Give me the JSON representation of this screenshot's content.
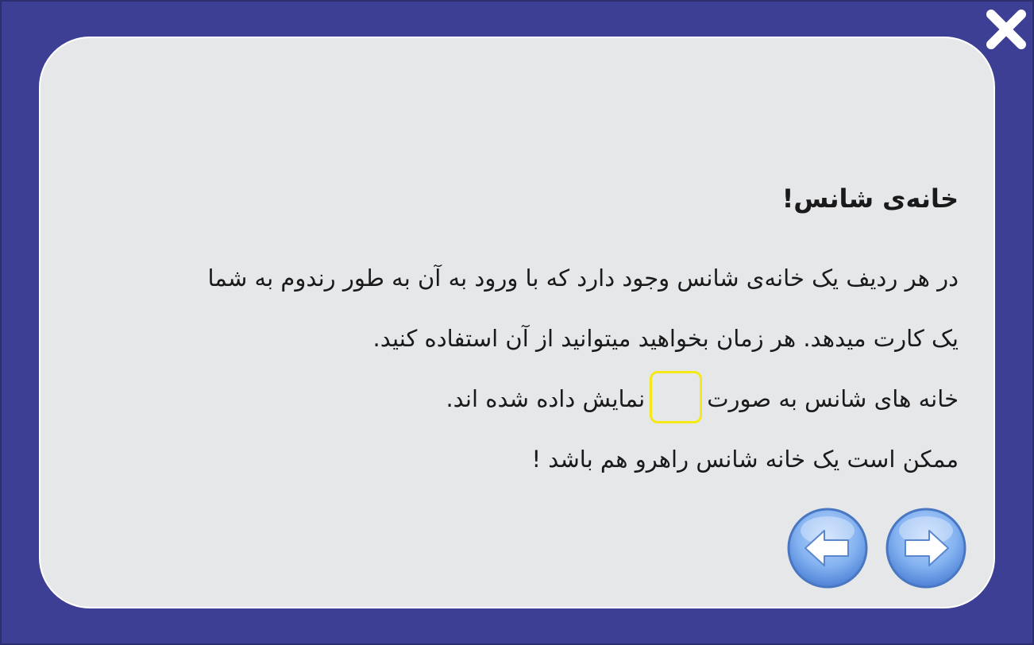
{
  "dialog": {
    "title": "خانه‌ی شانس!",
    "lines": [
      "در هر ردیف یک خانه‌ی شانس وجود دارد که با ورود به آن به طور رندوم به شما",
      " یک کارت میدهد. هر زمان بخواهید میتوانید از آن استفاده کنید."
    ],
    "line3_before": "خانه های شانس به صورت",
    "line3_after": "نمایش داده شده اند.",
    "line4": "ممکن است یک خانه شانس راهرو هم باشد !"
  },
  "colors": {
    "background": "#3c3f93",
    "panel": "#e6e7e9",
    "chance_box_border": "#f4e817",
    "nav_button": "#7aa9ef"
  },
  "icons": {
    "close": "close-icon",
    "next": "arrow-right-icon",
    "prev": "arrow-left-icon"
  }
}
